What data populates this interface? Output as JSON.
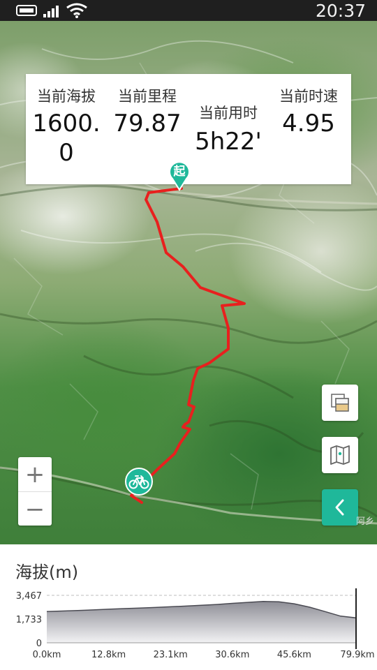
{
  "status_bar": {
    "time": "20:37",
    "icons": [
      "sim-card-icon",
      "signal-icon",
      "wifi-icon"
    ]
  },
  "stats": [
    {
      "label": "当前海拔",
      "value_lines": [
        "1600.",
        "0"
      ]
    },
    {
      "label": "当前里程",
      "value_lines": [
        "79.87"
      ]
    },
    {
      "label": "当前用时",
      "value_lines": [
        "5h22'"
      ]
    },
    {
      "label": "当前时速",
      "value_lines": [
        "4.95"
      ]
    }
  ],
  "map": {
    "start_marker_text": "起",
    "route_color": "#e8201e",
    "accent_color": "#1fb89a",
    "zoom_in_label": "+",
    "zoom_out_label": "−",
    "place_label": "阿乡",
    "buttons": [
      "layers-icon",
      "map-icon",
      "chevron-left-icon"
    ],
    "cyclist_icon": "bicycle-icon"
  },
  "elevation": {
    "title": "海拔(m)",
    "chart_data": {
      "type": "area",
      "title": "海拔(m)",
      "y_ticks": [
        "3,467",
        "1,733",
        "0"
      ],
      "y_tick_values": [
        3467,
        1733,
        0
      ],
      "x_ticks": [
        "0.0km",
        "12.8km",
        "23.1km",
        "30.6km",
        "45.6km",
        "79.9km"
      ],
      "ylim": [
        0,
        3467
      ],
      "series": [
        {
          "x_index": [
            0,
            1,
            2,
            3,
            4,
            5,
            6,
            7,
            8,
            9,
            10,
            11,
            12,
            13,
            14,
            15,
            16,
            17,
            18,
            19,
            20
          ],
          "values": [
            2280,
            2320,
            2360,
            2400,
            2450,
            2500,
            2540,
            2580,
            2630,
            2680,
            2740,
            2800,
            2880,
            2950,
            3020,
            3000,
            2850,
            2600,
            2280,
            1950,
            1820
          ]
        }
      ],
      "grid": true,
      "current_position": "79.9km"
    }
  }
}
